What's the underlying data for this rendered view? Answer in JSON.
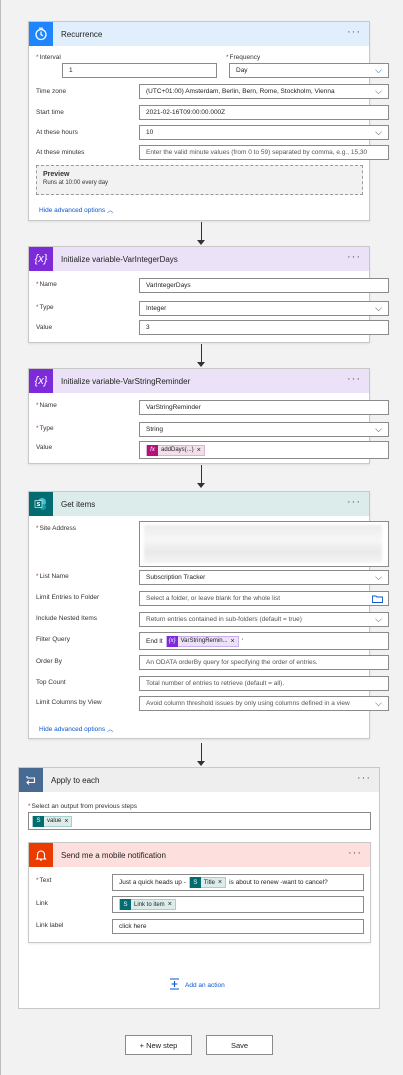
{
  "recurrence": {
    "title": "Recurrence",
    "interval_label": "Interval",
    "interval_value": "1",
    "frequency_label": "Frequency",
    "frequency_value": "Day",
    "timezone_label": "Time zone",
    "timezone_value": "(UTC+01:00) Amsterdam, Berlin, Bern, Rome, Stockholm, Vienna",
    "start_label": "Start time",
    "start_value": "2021-02-16T09:00:00.000Z",
    "hours_label": "At these hours",
    "hours_value": "10",
    "minutes_label": "At these minutes",
    "minutes_placeholder": "Enter the valid minute values (from 0 to 59) separated by comma, e.g., 15,30",
    "preview_title": "Preview",
    "preview_text": "Runs at 10:00 every day",
    "hide_advanced": "Hide advanced options"
  },
  "var_integer": {
    "title": "Initialize variable-VarIntegerDays",
    "name_label": "Name",
    "name_value": "VarIntegerDays",
    "type_label": "Type",
    "type_value": "Integer",
    "value_label": "Value",
    "value_value": "3"
  },
  "var_string": {
    "title": "Initialize variable-VarStringReminder",
    "name_label": "Name",
    "name_value": "VarStringReminder",
    "type_label": "Type",
    "type_value": "String",
    "value_label": "Value",
    "value_token": "addDays(...)"
  },
  "get_items": {
    "title": "Get items",
    "site_label": "Site Address",
    "list_label": "List Name",
    "list_value": "Subscription Tracker",
    "folder_label": "Limit Entries to Folder",
    "folder_placeholder": "Select a folder, or leave blank for the whole list",
    "nested_label": "Include Nested Items",
    "nested_placeholder": "Return entries contained in sub-folders (default = true)",
    "filter_label": "Filter Query",
    "filter_prefix": "End lt",
    "filter_token": "VarStringRemin...",
    "filter_suffix": "'",
    "orderby_label": "Order By",
    "orderby_placeholder": "An ODATA orderBy query for specifying the order of entries.",
    "top_label": "Top Count",
    "top_placeholder": "Total number of entries to retrieve (default = all).",
    "columns_label": "Limit Columns by View",
    "columns_placeholder": "Avoid column threshold issues by only using columns defined in a view",
    "hide_advanced": "Hide advanced options"
  },
  "apply_each": {
    "title": "Apply to each",
    "select_label": "Select an output from previous steps",
    "select_token": "value",
    "add_action": "Add an action"
  },
  "notification": {
    "title": "Send me a mobile notification",
    "text_label": "Text",
    "text_prefix": "Just a quick heads up -",
    "text_token": "Title",
    "text_suffix": "is about to renew -want to cancel?",
    "link_label": "Link",
    "link_token": "Link to item",
    "linklabel_label": "Link label",
    "linklabel_value": "click here"
  },
  "footer": {
    "new_step": "+ New step",
    "save": "Save"
  },
  "more_glyph": "···",
  "remove_glyph": "×",
  "colors": {
    "recurrence": "#1f85ff",
    "variable": "#7d2bd9",
    "sharepoint": "#036c70",
    "notification": "#eb3c00",
    "control": "#486991",
    "link": "#0a58ca"
  }
}
